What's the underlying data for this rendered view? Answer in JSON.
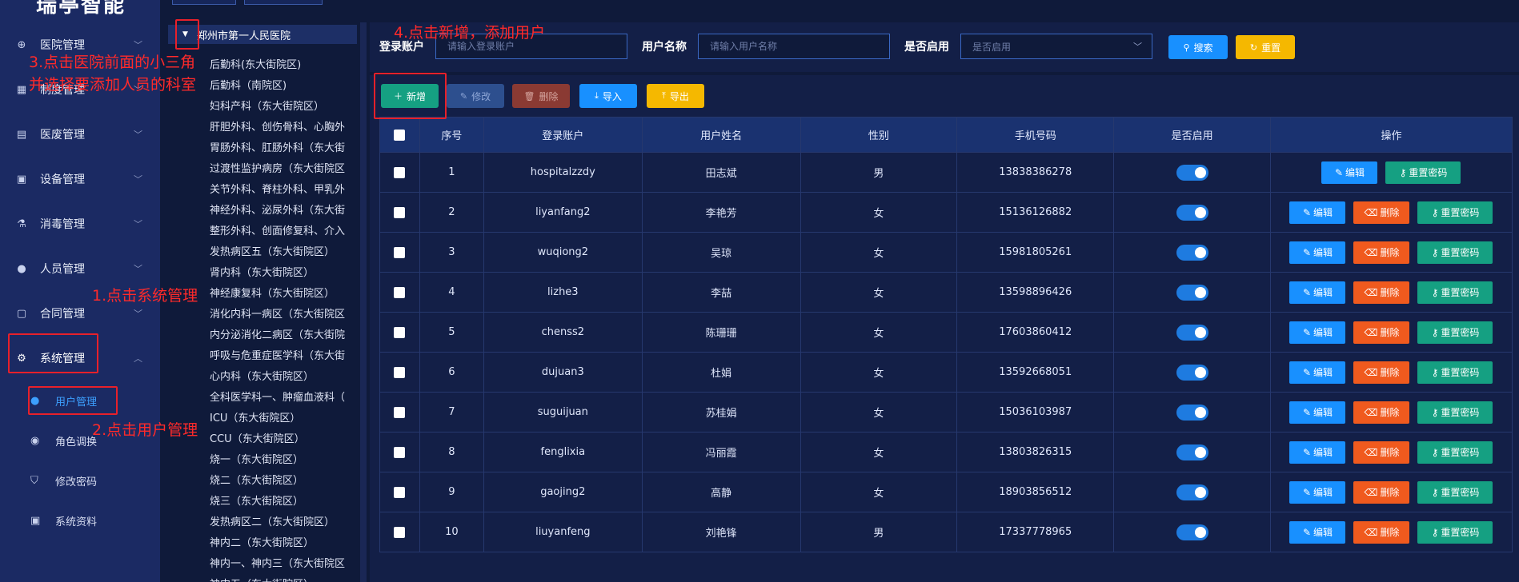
{
  "brand": "瑞亭智能",
  "sidebar": {
    "items": [
      {
        "label": "医院管理",
        "icon": "hospital-icon",
        "expanded": false
      },
      {
        "label": "制度管理",
        "icon": "grid-icon",
        "expanded": false
      },
      {
        "label": "医废管理",
        "icon": "document-icon",
        "expanded": false
      },
      {
        "label": "设备管理",
        "icon": "device-icon",
        "expanded": false
      },
      {
        "label": "消毒管理",
        "icon": "disinfect-icon",
        "expanded": false
      },
      {
        "label": "人员管理",
        "icon": "person-icon",
        "expanded": false
      },
      {
        "label": "合同管理",
        "icon": "contract-icon",
        "expanded": false
      },
      {
        "label": "系统管理",
        "icon": "gear-icon",
        "expanded": true
      }
    ],
    "sub_items": [
      {
        "label": "用户管理",
        "icon": "user-icon",
        "active": true
      },
      {
        "label": "角色调换",
        "icon": "role-icon",
        "active": false
      },
      {
        "label": "修改密码",
        "icon": "shield-icon",
        "active": false
      },
      {
        "label": "系统资料",
        "icon": "info-icon",
        "active": false
      }
    ]
  },
  "tree": {
    "root": "郑州市第一人民医院",
    "nodes": [
      "后勤科(东大街院区)",
      "后勤科（南院区)",
      "妇科产科（东大街院区）",
      "肝胆外科、创伤骨科、心胸外",
      "胃肠外科、肛肠外科（东大街",
      "过渡性监护病房（东大街院区",
      "关节外科、脊柱外科、甲乳外",
      "神经外科、泌尿外科（东大街",
      "整形外科、创面修复科、介入",
      "发热病区五（东大街院区）",
      "肾内科（东大街院区）",
      "神经康复科（东大街院区）",
      "消化内科一病区（东大街院区",
      "内分泌消化二病区（东大街院",
      "呼吸与危重症医学科（东大街",
      "心内科（东大街院区）",
      "全科医学科一、肿瘤血液科（",
      "ICU（东大街院区）",
      "CCU（东大街院区）",
      "烧一（东大街院区）",
      "烧二（东大街院区）",
      "烧三（东大街院区）",
      "发热病区二（东大街院区）",
      "神内二（东大街院区）",
      "神内一、神内三（东大街院区",
      "神内五（东大街院区）"
    ]
  },
  "search": {
    "account_label": "登录账户",
    "account_placeholder": "请输入登录账户",
    "name_label": "用户名称",
    "name_placeholder": "请输入用户名称",
    "enabled_label": "是否启用",
    "enabled_placeholder": "是否启用",
    "search_btn": "搜索",
    "reset_btn": "重置"
  },
  "toolbar": {
    "add": "新增",
    "edit": "修改",
    "delete": "删除",
    "import": "导入",
    "export": "导出"
  },
  "table": {
    "headers": [
      "序号",
      "登录账户",
      "用户姓名",
      "性别",
      "手机号码",
      "是否启用",
      "操作"
    ],
    "rows": [
      {
        "no": "1",
        "account": "hospitalzzdy",
        "name": "田志斌",
        "gender": "男",
        "phone": "13838386278",
        "enabled": true,
        "deletable": false
      },
      {
        "no": "2",
        "account": "liyanfang2",
        "name": "李艳芳",
        "gender": "女",
        "phone": "15136126882",
        "enabled": true,
        "deletable": true
      },
      {
        "no": "3",
        "account": "wuqiong2",
        "name": "吴琼",
        "gender": "女",
        "phone": "15981805261",
        "enabled": true,
        "deletable": true
      },
      {
        "no": "4",
        "account": "lizhe3",
        "name": "李喆",
        "gender": "女",
        "phone": "13598896426",
        "enabled": true,
        "deletable": true
      },
      {
        "no": "5",
        "account": "chenss2",
        "name": "陈珊珊",
        "gender": "女",
        "phone": "17603860412",
        "enabled": true,
        "deletable": true
      },
      {
        "no": "6",
        "account": "dujuan3",
        "name": "杜娟",
        "gender": "女",
        "phone": "13592668051",
        "enabled": true,
        "deletable": true
      },
      {
        "no": "7",
        "account": "suguijuan",
        "name": "苏桂娟",
        "gender": "女",
        "phone": "15036103987",
        "enabled": true,
        "deletable": true
      },
      {
        "no": "8",
        "account": "fenglixia",
        "name": "冯丽霞",
        "gender": "女",
        "phone": "13803826315",
        "enabled": true,
        "deletable": true
      },
      {
        "no": "9",
        "account": "gaojing2",
        "name": "高静",
        "gender": "女",
        "phone": "18903856512",
        "enabled": true,
        "deletable": true
      },
      {
        "no": "10",
        "account": "liuyanfeng",
        "name": "刘艳锋",
        "gender": "男",
        "phone": "17337778965",
        "enabled": true,
        "deletable": true
      }
    ],
    "op_edit": "编辑",
    "op_delete": "删除",
    "op_reset": "重置密码"
  },
  "annotations": {
    "step1": "1.点击系统管理",
    "step2": "2.点击用户管理",
    "step3_line1": "3.点击医院前面的小三角",
    "step3_line2": "并选择要添加人员的科室",
    "step4": "4.点击新增，添加用户"
  },
  "colors": {
    "annotation": "#e8202a",
    "add_button": "#15a082",
    "edit_button": "#1890ff",
    "delete_button": "#f05a1e",
    "reset_pwd_button": "#15a082",
    "search_button": "#1890ff",
    "reset_button": "#f5b800",
    "export_button": "#f5b800",
    "toggle_on": "#1e7be0"
  }
}
